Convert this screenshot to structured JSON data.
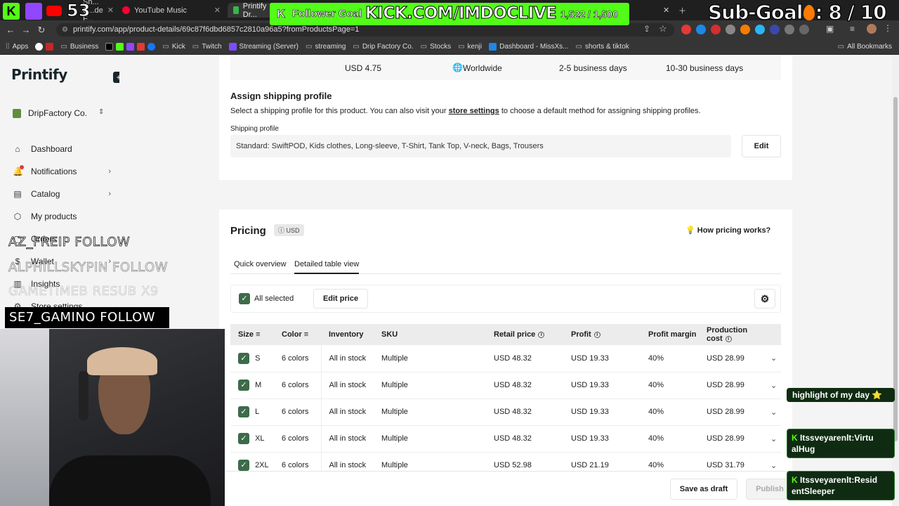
{
  "browser": {
    "tabs": [
      {
        "label": "Sh... S...de F...",
        "active": false
      },
      {
        "label": "YouTube Music",
        "active": false
      },
      {
        "label": "Printify Dr...",
        "active": true
      }
    ],
    "url": "printify.com/app/product-details/69c87f6dbd6857c2810a96a5?fromProductsPage=1",
    "bookmarks": [
      "Apps",
      "Business",
      "Kick",
      "Twitch",
      "Streaming (Server)",
      "streaming",
      "Drip Factory Co.",
      "Stocks",
      "kenji",
      "Dashboard - MissXs...",
      "shorts & tiktok"
    ],
    "all_bookmarks": "All Bookmarks"
  },
  "sidebar": {
    "logo": "Printify",
    "store_name": "DripFactory Co.",
    "items": [
      {
        "label": "Dashboard",
        "icon": "home-icon",
        "glyph": "⌂",
        "arrow": ""
      },
      {
        "label": "Notifications",
        "icon": "bell-icon",
        "glyph": "🔔",
        "arrow": "›"
      },
      {
        "label": "Catalog",
        "icon": "catalog-icon",
        "glyph": "▤",
        "arrow": "›"
      },
      {
        "label": "My products",
        "icon": "tag-icon",
        "glyph": "⬡",
        "arrow": ""
      },
      {
        "label": "Orders",
        "icon": "orders-icon",
        "glyph": "▢",
        "arrow": ""
      },
      {
        "label": "Wallet",
        "icon": "dollar-icon",
        "glyph": "$",
        "arrow": "›"
      },
      {
        "label": "Insights",
        "icon": "chart-icon",
        "glyph": "▥",
        "arrow": ""
      },
      {
        "label": "Store settings",
        "icon": "gear-icon",
        "glyph": "⚙",
        "arrow": ""
      }
    ]
  },
  "shipping_row": {
    "price": "USD 4.75",
    "region": "Worldwide",
    "time1": "2-5 business days",
    "time2": "10-30 business days"
  },
  "assign_shipping": {
    "title": "Assign shipping profile",
    "desc_before": "Select a shipping profile for this product. You can also visit your",
    "desc_link": "store settings",
    "desc_after": "to choose a default method for assigning shipping profiles.",
    "field_label": "Shipping profile",
    "field_value": "Standard: SwiftPOD, Kids clothes, Long-sleeve, T-Shirt, Tank Top, V-neck, Bags, Trousers",
    "edit_label": "Edit"
  },
  "pricing": {
    "title": "Pricing",
    "currency_badge": "USD",
    "help_link": "How pricing works?",
    "tabs": [
      "Quick overview",
      "Detailed table view"
    ],
    "active_tab": 1,
    "all_selected": "All selected",
    "edit_price": "Edit price",
    "columns": [
      "Size",
      "Color",
      "Inventory",
      "SKU",
      "Retail price",
      "Profit",
      "Profit margin",
      "Production cost"
    ],
    "rows": [
      {
        "size": "S",
        "color": "6 colors",
        "inventory": "All in stock",
        "sku": "Multiple",
        "retail": "USD 48.32",
        "profit": "USD 19.33",
        "margin": "40%",
        "cost": "USD 28.99"
      },
      {
        "size": "M",
        "color": "6 colors",
        "inventory": "All in stock",
        "sku": "Multiple",
        "retail": "USD 48.32",
        "profit": "USD 19.33",
        "margin": "40%",
        "cost": "USD 28.99"
      },
      {
        "size": "L",
        "color": "6 colors",
        "inventory": "All in stock",
        "sku": "Multiple",
        "retail": "USD 48.32",
        "profit": "USD 19.33",
        "margin": "40%",
        "cost": "USD 28.99"
      },
      {
        "size": "XL",
        "color": "6 colors",
        "inventory": "All in stock",
        "sku": "Multiple",
        "retail": "USD 48.32",
        "profit": "USD 19.33",
        "margin": "40%",
        "cost": "USD 28.99"
      },
      {
        "size": "2XL",
        "color": "6 colors",
        "inventory": "All in stock",
        "sku": "Multiple",
        "retail": "USD 52.98",
        "profit": "USD 21.19",
        "margin": "40%",
        "cost": "USD 31.79"
      }
    ]
  },
  "footer": {
    "save_draft": "Save as draft",
    "publish": "Publish"
  },
  "overlay": {
    "viewer_count": "53",
    "follower_goal_label": "Follower Goal",
    "follower_goal_url": "KICK.COM/IMDOCLIVE",
    "follower_goal_progress": "1,522 / 1,500",
    "sub_goal": "Sub-Goal",
    "sub_goal_progress": ": 8 / 10",
    "alerts": [
      "AZ_FREIP  FOLLOW",
      "ALPHILLSKYPIN  FOLLOW",
      "GAMETIMEB  RESUB X9"
    ],
    "alert_active": "SE7_GAMINO  FOLLOW",
    "chat": [
      {
        "text": "highlight of my day ⭐"
      },
      {
        "user": "Itssveyarenlt",
        "text": "Virtu alHug"
      },
      {
        "user": "Itssveyarenlt",
        "text": "Resid entSleeper"
      }
    ]
  },
  "colors": {
    "brand_dark": "#17262b",
    "checkbox_green": "#3d6b4a",
    "kick_green": "#53fc18"
  }
}
